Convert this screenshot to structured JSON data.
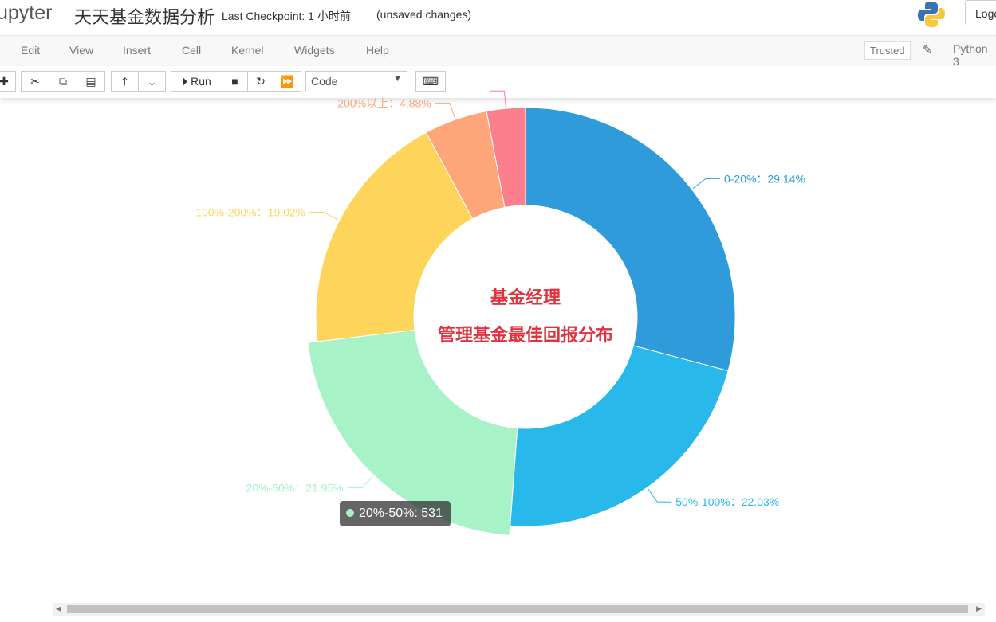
{
  "header": {
    "logo": "upyter",
    "notebook_name": "天天基金数据分析",
    "checkpoint": "Last Checkpoint: 1 小时前",
    "unsaved": "(unsaved changes)",
    "logout": "Logout"
  },
  "menu": {
    "items": [
      "Edit",
      "View",
      "Insert",
      "Cell",
      "Kernel",
      "Widgets",
      "Help"
    ],
    "trusted": "Trusted",
    "kernel": "Python 3"
  },
  "toolbar": {
    "run": "Run",
    "cell_type": "Code",
    "icons": [
      "plus-icon",
      "cut-icon",
      "copy-icon",
      "paste-icon",
      "arrow-up-icon",
      "arrow-down-icon",
      "run-icon",
      "stop-icon",
      "restart-icon",
      "fast-forward-icon",
      "keyboard-icon"
    ]
  },
  "chart_data": {
    "type": "pie",
    "title_line1": "基金经理",
    "title_line2": "管理基金最佳回报分布",
    "title_color": "#e0333f",
    "slices": [
      {
        "name": "0-20%",
        "percent": 29.14,
        "label": "0-20%：29.14%",
        "color": "#2f9bdb"
      },
      {
        "name": "50%-100%",
        "percent": 22.03,
        "label": "50%-100%：22.03%",
        "color": "#28b8ea"
      },
      {
        "name": "20%-50%",
        "percent": 21.95,
        "label": "20%-50%：21.95%",
        "color": "#a8f2c8",
        "highlighted": true
      },
      {
        "name": "100%-200%",
        "percent": 19.02,
        "label": "100%-200%：19.02%",
        "color": "#fed55a"
      },
      {
        "name": "200%以上",
        "percent": 4.88,
        "label": "200%以上：4.88%",
        "color": "#fea679"
      },
      {
        "name": "",
        "percent": 2.98,
        "label": "",
        "color": "#fd7f8e"
      }
    ],
    "tooltip": {
      "text": "20%-50%: 531",
      "color": "#a8f2c8"
    }
  }
}
